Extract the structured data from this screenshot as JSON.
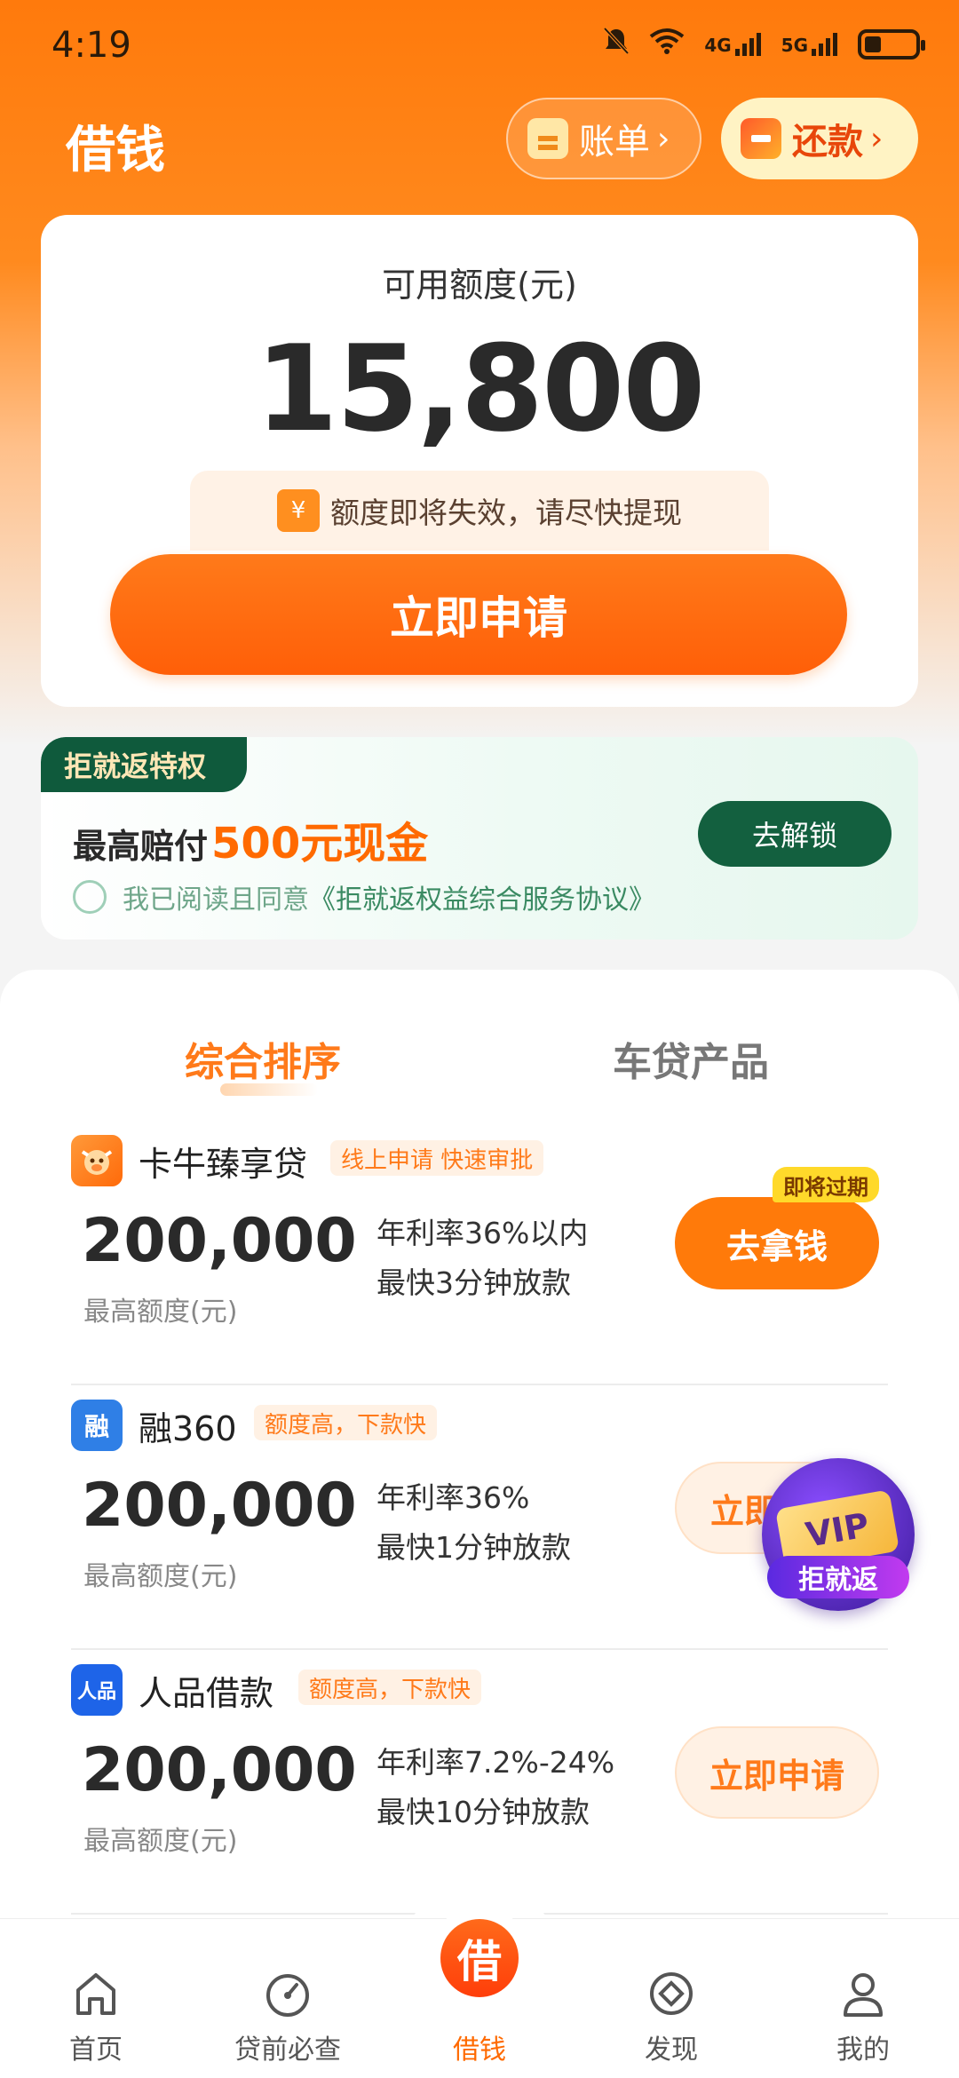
{
  "status_bar": {
    "time": "4:19",
    "network1": "4G",
    "network2": "5G"
  },
  "header": {
    "title": "借钱",
    "bill_label": "账单",
    "repay_label": "还款"
  },
  "credit": {
    "label": "可用额度(元)",
    "amount": "15,800",
    "yen_symbol": "¥",
    "notice": "额度即将失效，请尽快提现",
    "apply_label": "立即申请"
  },
  "privilege": {
    "tag": "拒就返特权",
    "text_prefix": "最高赔付",
    "text_highlight": "500元现金",
    "unlock_label": "去解锁",
    "agree_text": "我已阅读且同意",
    "agree_link": "《拒就返权益综合服务协议》"
  },
  "tabs": {
    "active": "综合排序",
    "inactive": "车贷产品"
  },
  "products": [
    {
      "name": "卡牛臻享贷",
      "tag": "线上申请 快速审批",
      "amount": "200,000",
      "amount_label": "最高额度(元)",
      "rate": "年利率36%以内",
      "speed": "最快3分钟放款",
      "button": "去拿钱",
      "badge": "即将过期",
      "logo_color": "#ff7a1a"
    },
    {
      "name": "融360",
      "tag": "额度高，下款快",
      "amount": "200,000",
      "amount_label": "最高额度(元)",
      "rate": "年利率36%",
      "speed": "最快1分钟放款",
      "button": "立即",
      "logo_text": "融",
      "logo_color": "#2f7fe6"
    },
    {
      "name": "人品借款",
      "tag": "额度高，下款快",
      "amount": "200,000",
      "amount_label": "最高额度(元)",
      "rate": "年利率7.2%-24%",
      "speed": "最快10分钟放款",
      "button": "立即申请",
      "logo_text": "人品",
      "logo_color": "#1e64e8"
    }
  ],
  "vip_float": {
    "card_text": "VIP",
    "label": "拒就返"
  },
  "bottom_nav": [
    {
      "label": "首页",
      "icon": "home-icon"
    },
    {
      "label": "贷前必查",
      "icon": "gauge-icon"
    },
    {
      "label": "借钱",
      "icon": "borrow-icon",
      "glyph": "借"
    },
    {
      "label": "发现",
      "icon": "compass-icon"
    },
    {
      "label": "我的",
      "icon": "profile-icon"
    }
  ]
}
